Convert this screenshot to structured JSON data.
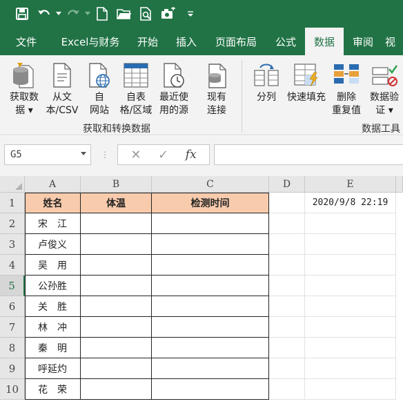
{
  "qat": {
    "icons": [
      "save-icon",
      "undo-icon",
      "redo-icon",
      "new-file-icon",
      "open-folder-icon",
      "print-preview-icon",
      "camera-icon",
      "customize-icon"
    ]
  },
  "tabs": [
    "文件",
    "Excel与财务",
    "开始",
    "插入",
    "页面布局",
    "公式",
    "数据",
    "审阅",
    "视"
  ],
  "active_tab": "数据",
  "ribbon": {
    "get_data_line1": "获取数",
    "get_data_line2": "据 ▾",
    "from_text_line1": "从文",
    "from_text_line2": "本/CSV",
    "from_web_line1": "自",
    "from_web_line2": "网站",
    "from_table_line1": "自表",
    "from_table_line2": "格/区域",
    "recent_line1": "最近使",
    "recent_line2": "用的源",
    "existing_line1": "现有",
    "existing_line2": "连接",
    "group1_label": "获取和转换数据",
    "split_label": "分列",
    "flash_fill_label": "快速填充",
    "remove_dup_line1": "删除",
    "remove_dup_line2": "重复值",
    "validation_line1": "数据验",
    "validation_line2": "证 ▾",
    "group2_label": "数据工具"
  },
  "formula_bar": {
    "name_box": "G5",
    "cancel": "✕",
    "enter": "✓",
    "fx": "fx",
    "value": ""
  },
  "columns": [
    "A",
    "B",
    "C",
    "D",
    "E"
  ],
  "rows": [
    "1",
    "2",
    "3",
    "4",
    "5",
    "6",
    "7",
    "8",
    "9",
    "10"
  ],
  "table": {
    "headers": [
      "姓名",
      "体温",
      "检测时间"
    ],
    "names": [
      "宋　江",
      "卢俊义",
      "吴　用",
      "公孙胜",
      "关　胜",
      "林　冲",
      "秦　明",
      "呼延灼",
      "花　荣"
    ]
  },
  "cell_e1": "2020/9/8 22:19",
  "colors": {
    "accent": "#217346",
    "header_fill": "#f8cbad"
  }
}
